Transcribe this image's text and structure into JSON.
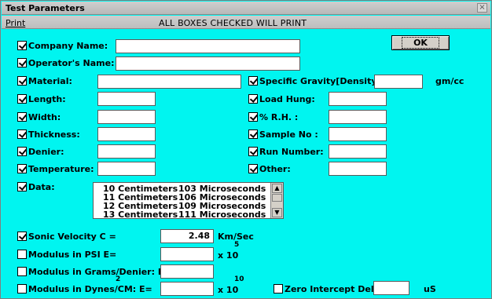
{
  "window": {
    "title": "Test Parameters",
    "close_glyph": "×"
  },
  "menu": {
    "print": "Print",
    "banner": "ALL BOXES CHECKED WILL PRINT"
  },
  "ok_button": "OK",
  "fields": {
    "company_name": {
      "label": "Company Name:",
      "checked": true,
      "value": ""
    },
    "operators_name": {
      "label": "Operator's Name:",
      "checked": true,
      "value": ""
    },
    "material": {
      "label": "Material:",
      "checked": true,
      "value": ""
    },
    "length": {
      "label": "Length:",
      "checked": true,
      "value": ""
    },
    "width": {
      "label": "Width:",
      "checked": true,
      "value": ""
    },
    "thickness": {
      "label": "Thickness:",
      "checked": true,
      "value": ""
    },
    "denier": {
      "label": "Denier:",
      "checked": true,
      "value": ""
    },
    "temperature": {
      "label": "Temperature:",
      "checked": true,
      "value": ""
    },
    "specific_gravity": {
      "label": "Specific Gravity[Density] :",
      "checked": true,
      "value": "",
      "unit": "gm/cc"
    },
    "load_hung": {
      "label": "Load Hung:",
      "checked": true,
      "value": ""
    },
    "rh": {
      "label": "% R.H. :",
      "checked": true,
      "value": ""
    },
    "sample_no": {
      "label": "Sample No :",
      "checked": true,
      "value": ""
    },
    "run_number": {
      "label": "Run Number:",
      "checked": true,
      "value": ""
    },
    "other": {
      "label": "Other:",
      "checked": true,
      "value": ""
    }
  },
  "data": {
    "label": "Data:",
    "checked": true,
    "rows": [
      {
        "cm": "10 Centimeters",
        "us": "103 Microseconds"
      },
      {
        "cm": "11 Centimeters",
        "us": "106 Microseconds"
      },
      {
        "cm": "12 Centimeters",
        "us": "109 Microseconds"
      },
      {
        "cm": "13 Centimeters",
        "us": "111 Microseconds"
      }
    ]
  },
  "results": {
    "sonic_velocity": {
      "label": "Sonic Velocity  C =",
      "checked": true,
      "value": "2.48",
      "unit": "Km/Sec"
    },
    "modulus_psi": {
      "label": "Modulus in PSI  E=",
      "checked": false,
      "value": "",
      "unit": "x 10",
      "exp": "5"
    },
    "modulus_grams_denier": {
      "label": "Modulus in Grams/Denier: E=",
      "checked": false,
      "value": ""
    },
    "modulus_dynes": {
      "label": "Modulus in Dynes/CM:   E=",
      "checked": false,
      "value": "",
      "sup": "2",
      "unit": "x 10",
      "exp": "10"
    },
    "zero_intercept": {
      "label": "Zero Intercept Delay:",
      "checked": false,
      "value": "",
      "unit": "uS"
    }
  }
}
